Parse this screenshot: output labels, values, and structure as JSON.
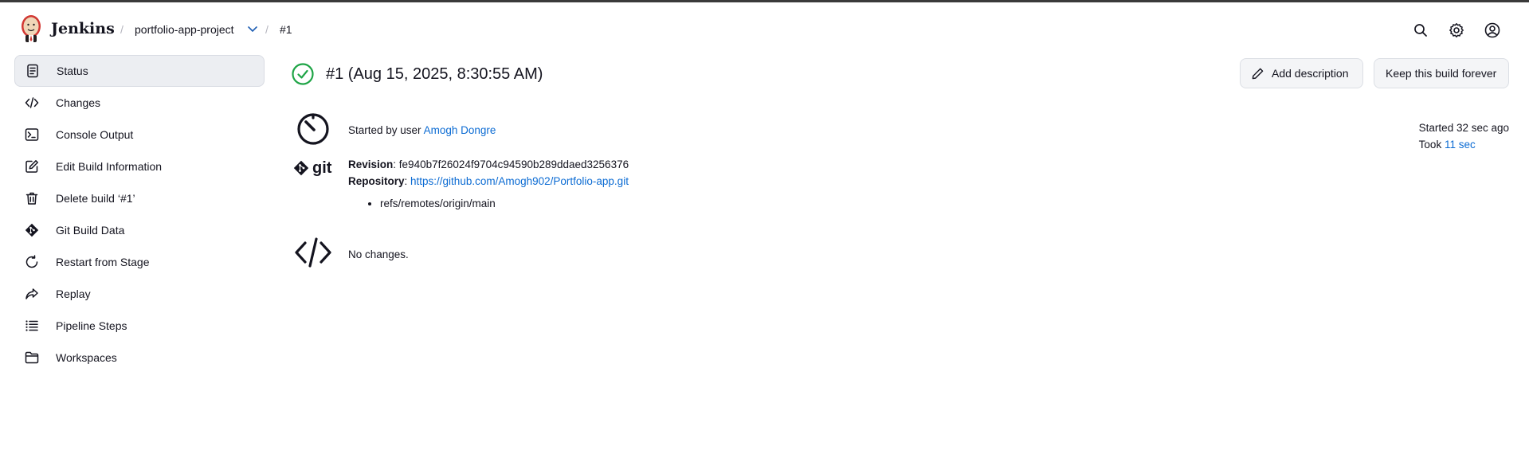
{
  "header": {
    "brand": "Jenkins",
    "breadcrumbs": [
      {
        "label": "portfolio-app-project"
      },
      {
        "label": "#1"
      }
    ],
    "separator": "/"
  },
  "sidebar": {
    "items": [
      {
        "label": "Status",
        "icon": "status-icon",
        "active": true
      },
      {
        "label": "Changes",
        "icon": "code-icon"
      },
      {
        "label": "Console Output",
        "icon": "terminal-icon"
      },
      {
        "label": "Edit Build Information",
        "icon": "edit-icon"
      },
      {
        "label": "Delete build ‘#1’",
        "icon": "trash-icon"
      },
      {
        "label": "Git Build Data",
        "icon": "git-icon"
      },
      {
        "label": "Restart from Stage",
        "icon": "restart-icon"
      },
      {
        "label": "Replay",
        "icon": "replay-icon"
      },
      {
        "label": "Pipeline Steps",
        "icon": "list-icon"
      },
      {
        "label": "Workspaces",
        "icon": "folder-icon"
      }
    ]
  },
  "main": {
    "title": "#1 (Aug 15, 2025, 8:30:55 AM)",
    "status_color": "#1ea446",
    "buttons": {
      "add_description": "Add description",
      "keep_forever": "Keep this build forever"
    },
    "started": {
      "prefix": "Started by user",
      "user": "Amogh Dongre"
    },
    "git": {
      "logo_text": "git",
      "revision_label": "Revision",
      "revision": "fe940b7f26024f9704c94590b289ddaed3256376",
      "repository_label": "Repository",
      "repository": "https://github.com/Amogh902/Portfolio-app.git",
      "branches": [
        "refs/remotes/origin/main"
      ]
    },
    "changes": {
      "text": "No changes."
    },
    "meta": {
      "started": "Started 32 sec ago",
      "took_prefix": "Took",
      "took": "11 sec"
    }
  },
  "colors": {
    "accent": "#0b6bd3",
    "active_bg": "#eceef2"
  }
}
